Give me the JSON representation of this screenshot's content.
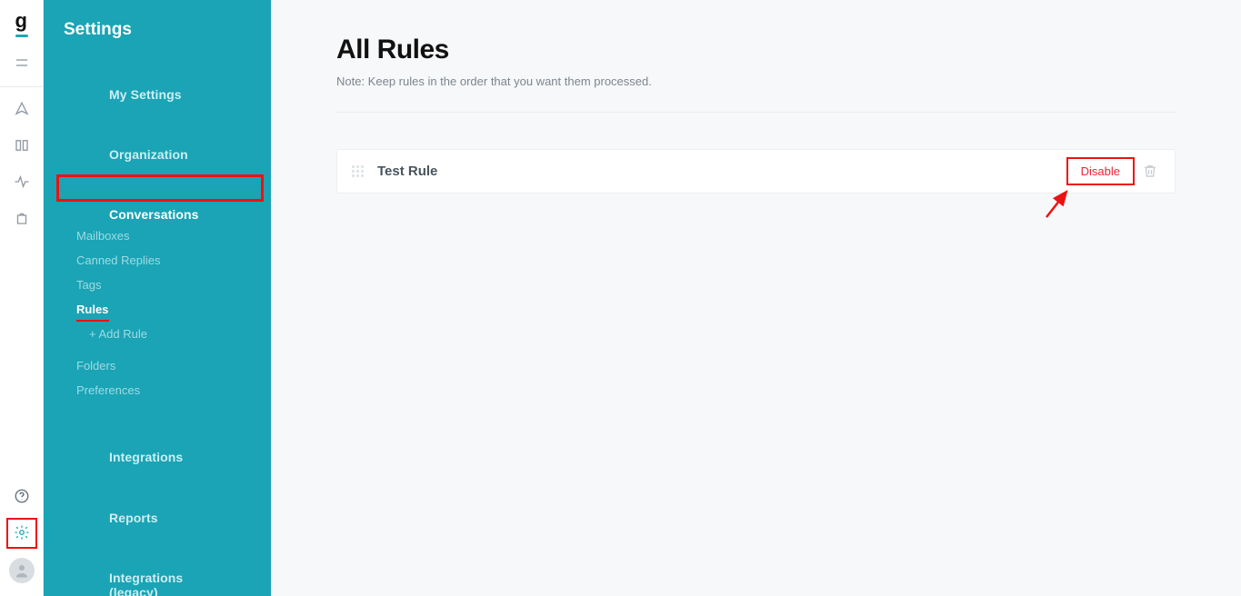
{
  "sidebar": {
    "title": "Settings",
    "items": {
      "my_settings": "My Settings",
      "organization": "Organization",
      "conversations": "Conversations",
      "integrations": "Integrations",
      "reports": "Reports",
      "integrations_legacy": "Integrations (legacy)"
    },
    "conversations_sub": {
      "mailboxes": "Mailboxes",
      "canned_replies": "Canned Replies",
      "tags": "Tags",
      "rules": "Rules",
      "add_rule": "+ Add Rule",
      "folders": "Folders",
      "preferences": "Preferences"
    }
  },
  "main": {
    "heading": "All Rules",
    "note": "Note: Keep rules in the order that you want them processed.",
    "rules": [
      {
        "name": "Test Rule",
        "action_label": "Disable"
      }
    ]
  }
}
